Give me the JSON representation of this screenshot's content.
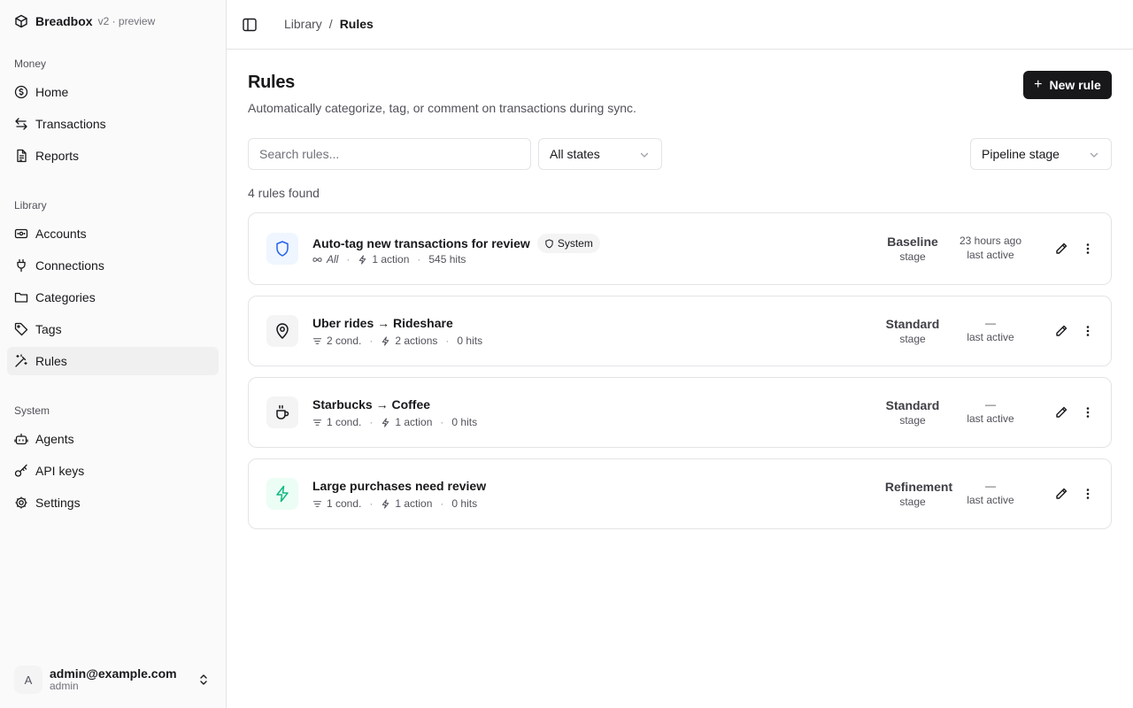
{
  "brand": {
    "name": "Breadbox",
    "version": "v2 · preview"
  },
  "sidebar": {
    "money_label": "Money",
    "library_label": "Library",
    "system_label": "System",
    "money": [
      {
        "label": "Home",
        "icon": "dollar-circle-icon"
      },
      {
        "label": "Transactions",
        "icon": "arrows-swap-icon"
      },
      {
        "label": "Reports",
        "icon": "document-icon"
      }
    ],
    "library": [
      {
        "label": "Accounts",
        "icon": "wallet-icon"
      },
      {
        "label": "Connections",
        "icon": "plug-icon"
      },
      {
        "label": "Categories",
        "icon": "folder-icon"
      },
      {
        "label": "Tags",
        "icon": "tag-icon"
      },
      {
        "label": "Rules",
        "icon": "magic-wand-icon"
      }
    ],
    "system": [
      {
        "label": "Agents",
        "icon": "bot-icon"
      },
      {
        "label": "API keys",
        "icon": "key-icon"
      },
      {
        "label": "Settings",
        "icon": "gear-icon"
      }
    ],
    "user": {
      "initial": "A",
      "email": "admin@example.com",
      "role": "admin"
    }
  },
  "breadcrumb": {
    "parent": "Library",
    "separator": "/",
    "current": "Rules"
  },
  "page": {
    "title": "Rules",
    "subtitle": "Automatically categorize, tag, or comment on transactions during sync.",
    "new_button": "New rule",
    "search_placeholder": "Search rules...",
    "state_filter": "All states",
    "stage_filter": "Pipeline stage",
    "count": "4 rules found"
  },
  "rules": [
    {
      "name": "Auto-tag new transactions for review",
      "tag": "System",
      "icon": "shield-icon",
      "icon_color": "#2563eb",
      "icon_bg": "#eff6ff",
      "cond": "All",
      "actions": "1 action",
      "hits": "545 hits",
      "stage": "Baseline",
      "stage_label": "stage",
      "last_active": "23 hours ago",
      "last_active_label": "last active"
    },
    {
      "name": "Uber rides → Rideshare",
      "icon": "map-pin-icon",
      "icon_color": "#18181b",
      "icon_bg": "#f4f4f5",
      "cond": "2 cond.",
      "actions": "2 actions",
      "hits": "0 hits",
      "stage": "Standard",
      "stage_label": "stage",
      "last_active": "—",
      "last_active_label": "last active"
    },
    {
      "name": "Starbucks → Coffee",
      "icon": "coffee-icon",
      "icon_color": "#18181b",
      "icon_bg": "#f4f4f5",
      "cond": "1 cond.",
      "actions": "1 action",
      "hits": "0 hits",
      "stage": "Standard",
      "stage_label": "stage",
      "last_active": "—",
      "last_active_label": "last active"
    },
    {
      "name": "Large purchases need review",
      "icon": "lightning-icon",
      "icon_color": "#10b981",
      "icon_bg": "#ecfdf5",
      "cond": "1 cond.",
      "actions": "1 action",
      "hits": "0 hits",
      "stage": "Refinement",
      "stage_label": "stage",
      "last_active": "—",
      "last_active_label": "last active"
    }
  ]
}
